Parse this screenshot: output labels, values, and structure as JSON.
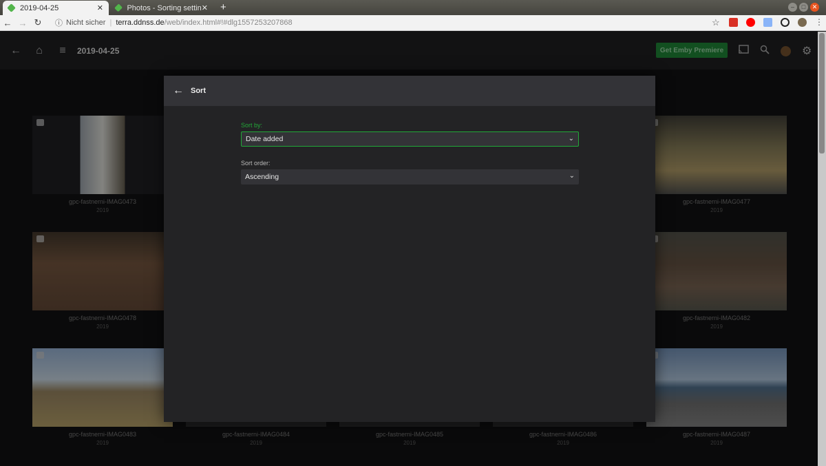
{
  "browser": {
    "tabs": [
      {
        "title": "2019-04-25",
        "active": true
      },
      {
        "title": "Photos - Sorting setting i",
        "active": false
      }
    ],
    "new_tab": "+",
    "security": "Nicht sicher",
    "url_host": "terra.ddnss.de",
    "url_path": "/web/index.html#!#dlg1557253207868"
  },
  "header": {
    "title": "2019-04-25",
    "premiere_button": "Get Emby Premiere",
    "accent": "#1d7a32"
  },
  "tiles": [
    {
      "title": "gpc-fastnerni-IMAG0473",
      "year": "2019"
    },
    {
      "title": "",
      "year": ""
    },
    {
      "title": "",
      "year": ""
    },
    {
      "title": "",
      "year": ""
    },
    {
      "title": "gpc-fastnerni-IMAG0477",
      "year": "2019"
    },
    {
      "title": "gpc-fastnerni-IMAG0478",
      "year": "2019"
    },
    {
      "title": "",
      "year": ""
    },
    {
      "title": "",
      "year": ""
    },
    {
      "title": "",
      "year": ""
    },
    {
      "title": "gpc-fastnerni-IMAG0482",
      "year": "2019"
    },
    {
      "title": "gpc-fastnerni-IMAG0483",
      "year": "2019"
    },
    {
      "title": "gpc-fastnerni-IMAG0484",
      "year": "2019"
    },
    {
      "title": "gpc-fastnerni-IMAG0485",
      "year": "2019"
    },
    {
      "title": "gpc-fastnerni-IMAG0486",
      "year": "2019"
    },
    {
      "title": "gpc-fastnerni-IMAG0487",
      "year": "2019"
    }
  ],
  "dialog": {
    "title": "Sort",
    "sort_by": {
      "label": "Sort by:",
      "value": "Date added"
    },
    "sort_order": {
      "label": "Sort order:",
      "value": "Ascending"
    },
    "focus_color": "#22a838"
  }
}
